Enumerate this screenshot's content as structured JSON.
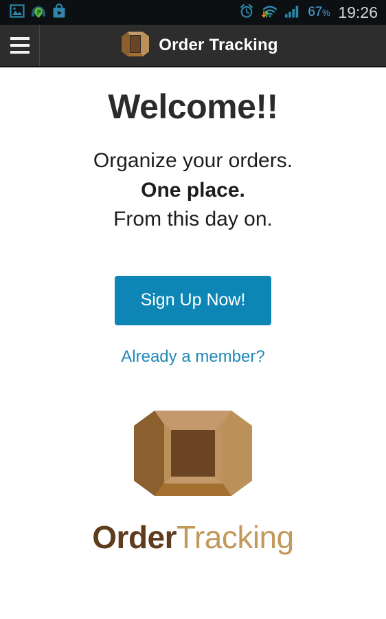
{
  "status_bar": {
    "left_icons": [
      {
        "name": "gallery-image-icon",
        "label": "Gallery"
      },
      {
        "name": "music-headphone-icon",
        "label": "Music player"
      },
      {
        "name": "play-store-bag-icon",
        "label": "Play Store"
      }
    ],
    "right_icons": [
      {
        "name": "alarm-clock-icon",
        "label": "Alarm set"
      },
      {
        "name": "wifi-data-transfer-icon",
        "label": "Wi-Fi"
      },
      {
        "name": "signal-bars-icon",
        "label": "Signal"
      }
    ],
    "battery_percent": "67",
    "percent_sign": "%",
    "clock": "19:26",
    "background_color": "#0c1013",
    "battery_color": "#4fa8d8",
    "clock_color": "#d4d4d4"
  },
  "app_bar": {
    "menu_icon": "hamburger-menu-icon",
    "logo_icon": "order-tracking-box-icon",
    "title": "Order Tracking",
    "background_color": "#2d2d2d",
    "title_color": "#ffffff"
  },
  "main": {
    "heading": "Welcome!!",
    "tagline": [
      {
        "text": "Organize your orders.",
        "bold": false
      },
      {
        "text": "One place.",
        "bold": true
      },
      {
        "text": "From this day on.",
        "bold": false
      }
    ],
    "signup_button_label": "Sign Up Now!",
    "member_link_label": "Already a member?",
    "accent_color": "#0d86b5",
    "link_color": "#1f89b8",
    "heading_color": "#2b2b2b"
  },
  "logo": {
    "icon_name": "order-tracking-box-logo",
    "wordmark_first": "Order",
    "wordmark_second": "Tracking",
    "first_color": "#5f3c1d",
    "second_color": "#c19a5b",
    "box_colors": {
      "top_flap": "#c49a6c",
      "left_flap": "#8c5f2e",
      "right_flap": "#bc9059",
      "bottom_flap": "#a3702f",
      "inner": "#6b4423",
      "rim": "#c49a6c"
    }
  }
}
